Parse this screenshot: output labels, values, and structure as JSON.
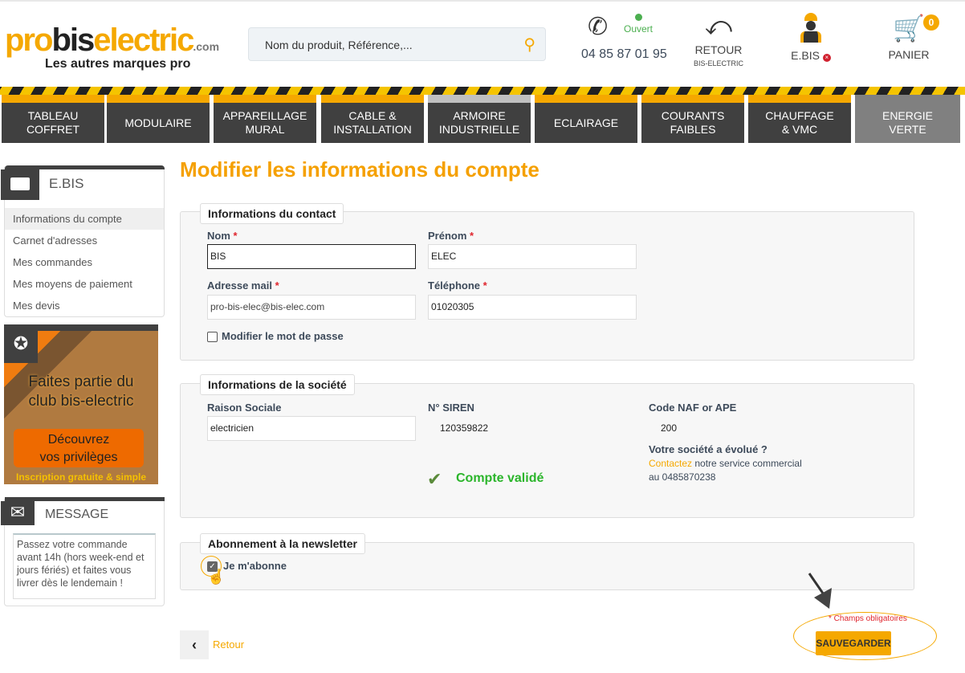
{
  "header": {
    "logo": {
      "pro": "pro",
      "bis": "bis",
      "electric": "electric",
      "com": ".com"
    },
    "tagline": "Les autres marques pro",
    "search_placeholder": "Nom du produit, Référence,...",
    "phone": "04 85 87 01 95",
    "status": "Ouvert",
    "retour": "RETOUR",
    "retour_sub": "BIS-ELECTRIC",
    "account": "E.BIS",
    "cart": "PANIER",
    "cart_count": "0"
  },
  "nav": [
    {
      "l1": "TABLEAU",
      "l2": "COFFRET"
    },
    {
      "l1": "MODULAIRE",
      "l2": ""
    },
    {
      "l1": "APPAREILLAGE",
      "l2": "MURAL"
    },
    {
      "l1": "CABLE &",
      "l2": "INSTALLATION"
    },
    {
      "l1": "ARMOIRE",
      "l2": "INDUSTRIELLE"
    },
    {
      "l1": "ECLAIRAGE",
      "l2": ""
    },
    {
      "l1": "COURANTS",
      "l2": "FAIBLES"
    },
    {
      "l1": "CHAUFFAGE",
      "l2": "& VMC"
    },
    {
      "l1": "ENERGIE",
      "l2": "VERTE"
    }
  ],
  "sidebar": {
    "title": "E.BIS",
    "items": [
      "Informations du compte",
      "Carnet d'adresses",
      "Mes commandes",
      "Mes moyens de paiement",
      "Mes devis"
    ],
    "promo": {
      "line1": "Faites partie du",
      "line2": "club bis-electric",
      "cta1": "Découvrez",
      "cta2": "vos privilèges",
      "footer": "Inscription gratuite & simple"
    },
    "message_title": "MESSAGE",
    "message": "Passez votre commande avant 14h (hors week-end et jours fériés) et faites vous livrer dès le lendemain !"
  },
  "main": {
    "title": "Modifier les informations du compte",
    "contact": {
      "legend": "Informations du contact",
      "nom_label": "Nom",
      "nom": "BIS",
      "prenom_label": "Prénom",
      "prenom": "ELEC",
      "email_label": "Adresse mail",
      "email": "pro-bis-elec@bis-elec.com",
      "tel_label": "Téléphone",
      "tel": "01020305",
      "pwd_label": "Modifier le mot de passe",
      "required": "*"
    },
    "company": {
      "legend": "Informations de la société",
      "raison_label": "Raison Sociale",
      "raison": "electricien",
      "siren_label": "N° SIREN",
      "siren": "120359822",
      "naf_label": "Code NAF or APE",
      "naf": "200",
      "evolve": "Votre société a évolué ?",
      "contact_link": "Contactez",
      "contact_text": " notre service commercial",
      "contact_phone": "au 0485870238",
      "validated": "Compte validé"
    },
    "newsletter": {
      "legend": "Abonnement à la newsletter",
      "label": "Je m'abonne",
      "checked": true
    },
    "required_note": "* Champs obligatoires",
    "back": "Retour",
    "save": "SAUVEGARDER"
  },
  "colors": {
    "accent": "#f5a800",
    "nav": "#404040",
    "success": "#2bb52b",
    "required": "#e0262e"
  }
}
